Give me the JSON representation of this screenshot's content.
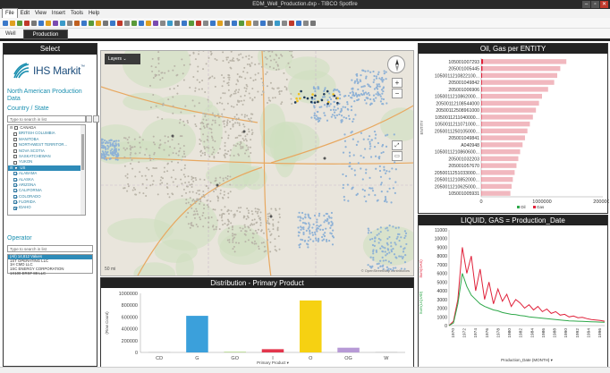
{
  "window": {
    "title": "EDM_Well_Production.dxp - TIBCO Spotfire"
  },
  "menu": [
    "File",
    "Edit",
    "View",
    "Insert",
    "Tools",
    "Help"
  ],
  "tabs": [
    {
      "label": "Well"
    },
    {
      "label": "Production"
    }
  ],
  "left": {
    "header": "Select",
    "logo_text": "IHS Markit",
    "logo_sup": "™",
    "subtitle": "North American Production Data",
    "country_label": "Country / State",
    "search_placeholder": "Type to search in list",
    "countries": [
      {
        "label": "CANADA",
        "level": 0,
        "checked": false
      },
      {
        "label": "BRITISH COLUMBIA",
        "level": 1,
        "checked": false
      },
      {
        "label": "MANITOBA",
        "level": 1,
        "checked": false
      },
      {
        "label": "NORTHWEST TERRITOR...",
        "level": 1,
        "checked": false
      },
      {
        "label": "NOVA SCOTIA",
        "level": 1,
        "checked": false
      },
      {
        "label": "SASKATCHEWAN",
        "level": 1,
        "checked": false
      },
      {
        "label": "YUKON",
        "level": 1,
        "checked": false
      },
      {
        "label": "US",
        "level": 0,
        "checked": true,
        "selected": true
      },
      {
        "label": "ALABAMA",
        "level": 1,
        "checked": true
      },
      {
        "label": "ALASKA",
        "level": 1,
        "checked": true
      },
      {
        "label": "ARIZONA",
        "level": 1,
        "checked": true
      },
      {
        "label": "CALIFORNIA",
        "level": 1,
        "checked": true
      },
      {
        "label": "COLORADO",
        "level": 1,
        "checked": true
      },
      {
        "label": "FLORIDA",
        "level": 1,
        "checked": true
      },
      {
        "label": "IDAHO",
        "level": 1,
        "checked": true
      }
    ],
    "operator_label": "Operator",
    "operator_placeholder": "Type to search in list",
    "operators": [
      {
        "label": "(All) 14,812 Values",
        "selected": true
      },
      {
        "label": "1ST OPERATING LLC"
      },
      {
        "label": "1H CMD LLC"
      },
      {
        "label": "1SC ENERGY CORPORATION"
      },
      {
        "label": "1X100 ERSF 88 LLC"
      }
    ]
  },
  "map": {
    "layers_label": "Layers",
    "scale": "50 mi",
    "attribution": "© OpenStreetMap contributors"
  },
  "oil_chart": {
    "title": "Oil, Gas per ENTITY",
    "y_axis_label": "ENTITY",
    "x_ticks": [
      "0",
      "1000000",
      "2000000"
    ],
    "legend": [
      {
        "name": "Oil",
        "color": "#2ea84a"
      },
      {
        "name": "Gas",
        "color": "#e0213a"
      }
    ]
  },
  "liquid_chart": {
    "title": "LIQUID, GAS = Production_Date",
    "x_label": "Production_Date (MONTH)",
    "y_label_left": "Sum(GAS)",
    "y_label_right": "Sum(LIQUID)"
  },
  "dist_chart": {
    "title": "Distribution - Primary Product",
    "y_label": "(Row Count)",
    "x_label": "Primary Product"
  },
  "chart_data": [
    {
      "type": "bar",
      "title": "Distribution - Primary Product",
      "xlabel": "Primary Product",
      "ylabel": "(Row Count)",
      "categories": [
        "CD",
        "G",
        "GO",
        "I",
        "O",
        "OG",
        "W"
      ],
      "values": [
        3000,
        620000,
        8000,
        55000,
        880000,
        80000,
        2000
      ],
      "colors": [
        "#999999",
        "#3ba0db",
        "#8bc34a",
        "#e3364d",
        "#f6d112",
        "#b79ad6",
        "#777777"
      ],
      "y_ticks": [
        0,
        200000,
        400000,
        600000,
        800000,
        1000000
      ],
      "ylim": [
        0,
        1000000
      ],
      "grid": false
    },
    {
      "type": "bar",
      "title": "Oil, Gas per ENTITY",
      "ylabel": "ENTITY",
      "categories": [
        "105001007293",
        "205001005445",
        "1050011210822100...",
        "205001049842",
        "205001006906",
        "1050011210862000...",
        "20500112108544000",
        "20500112508961000",
        "1050011211040000...",
        "1050011211071000...",
        "2050011250105000...",
        "205001049841",
        "A040948",
        "1050011210860600...",
        "205001032203",
        "205001057670",
        "2050011251033000...",
        "2050011210852000...",
        "2050011210625000...",
        "105001005931"
      ],
      "series": [
        {
          "name": "Oil",
          "values": [
            30000,
            20000,
            15000,
            12000,
            10000,
            9000,
            8000,
            7000,
            7000,
            6000,
            6000,
            5000,
            5000,
            4000,
            4000,
            4000,
            3000,
            3000,
            3000,
            3000
          ]
        },
        {
          "name": "Gas",
          "values": [
            1400000,
            1300000,
            1250000,
            1200000,
            1100000,
            1000000,
            950000,
            900000,
            850000,
            800000,
            760000,
            720000,
            680000,
            640000,
            610000,
            580000,
            550000,
            520000,
            500000,
            480000
          ]
        }
      ],
      "x_ticks": [
        0,
        1000000,
        2000000
      ],
      "xlim": [
        0,
        2000000
      ]
    },
    {
      "type": "line",
      "title": "LIQUID, GAS = Production_Date",
      "xlabel": "Production_Date (MONTH)",
      "y_ticks": [
        0,
        1000,
        2000,
        3000,
        4000,
        5000,
        6000,
        7000,
        8000,
        9000,
        10000,
        11000
      ],
      "ylim": [
        0,
        11000
      ],
      "x_ticks": [
        "1970",
        "1972",
        "1974",
        "1976",
        "1978",
        "1980",
        "1982",
        "1984",
        "1986",
        "1988",
        "1990",
        "1992",
        "1994",
        "1996"
      ],
      "series": [
        {
          "name": "Sum(GAS)",
          "color": "#e0213a",
          "values": [
            0,
            500,
            3000,
            9000,
            6000,
            8000,
            4000,
            6500,
            3000,
            5000,
            2500,
            4200,
            2800,
            3600,
            2200,
            3000,
            2600,
            2000,
            2400,
            1800,
            2200,
            1600,
            1900,
            1400,
            1600,
            1200,
            1300,
            1000,
            1100,
            900,
            950,
            800,
            700,
            650,
            600,
            500
          ]
        },
        {
          "name": "Sum(LIQUID)",
          "color": "#2ea84a",
          "values": [
            0,
            300,
            2500,
            6000,
            4500,
            3500,
            3000,
            2500,
            2200,
            2000,
            1800,
            1700,
            1500,
            1400,
            1300,
            1250,
            1150,
            1100,
            1000,
            950,
            900,
            850,
            800,
            750,
            700,
            650,
            600,
            550,
            520,
            500,
            480,
            460,
            440,
            420,
            400,
            380
          ]
        }
      ]
    }
  ]
}
